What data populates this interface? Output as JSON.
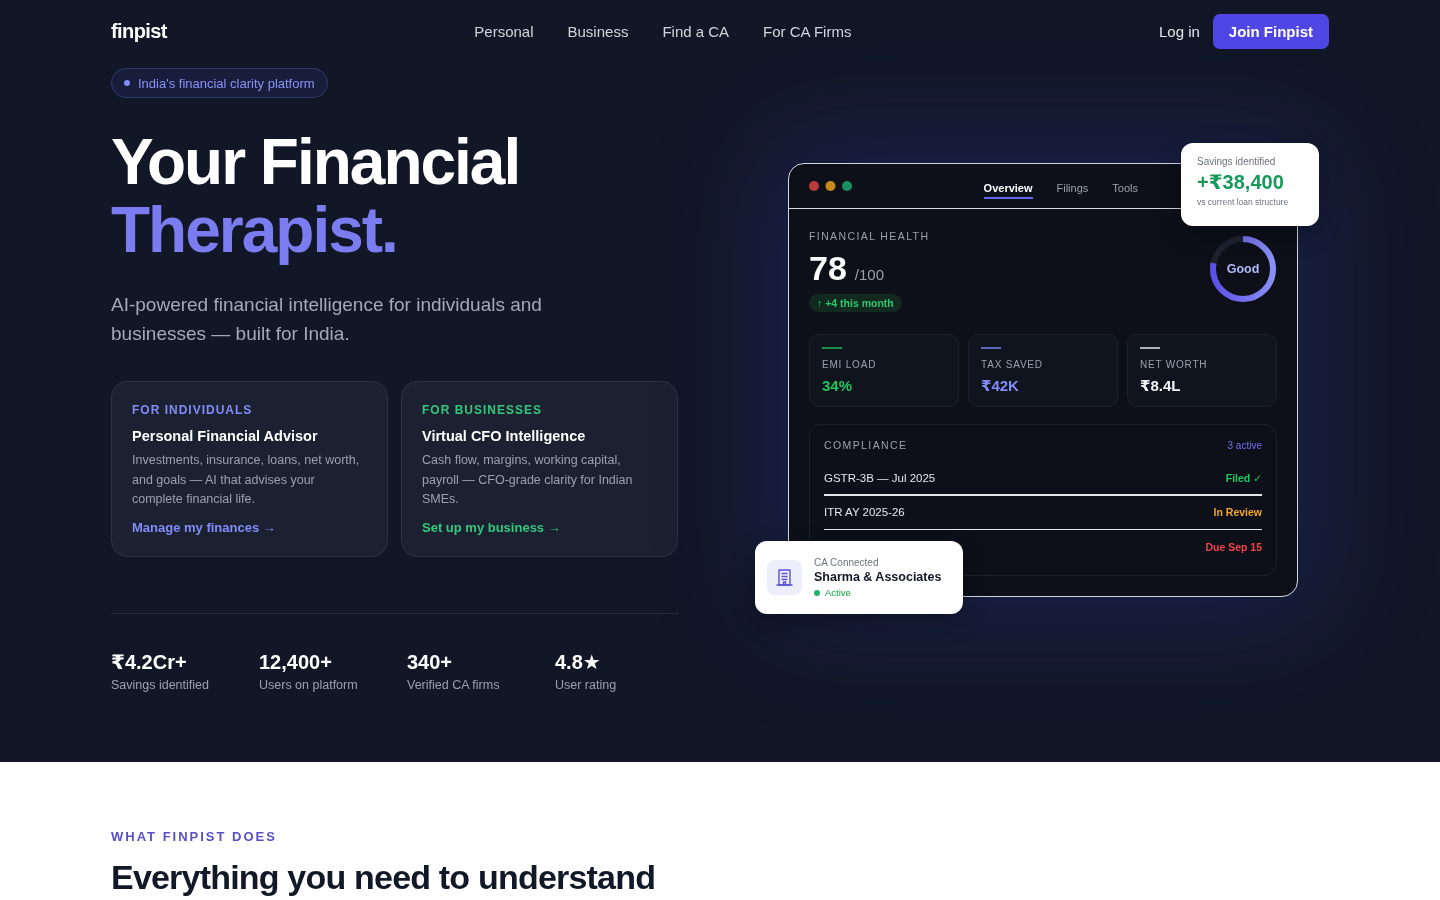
{
  "nav": {
    "logo": "finpist",
    "links": [
      {
        "label": "Personal"
      },
      {
        "label": "Business"
      },
      {
        "label": "Find a CA"
      },
      {
        "label": "For CA Firms"
      }
    ],
    "login": "Log in",
    "cta": "Join Finpist"
  },
  "hero": {
    "badge": "India's financial clarity platform",
    "title": "Your Financial",
    "title_accent": "Therapist.",
    "subtitle": "AI-powered financial intelligence for individuals and businesses — built for India.",
    "audience_cards": [
      {
        "eyebrow": "FOR INDIVIDUALS",
        "title": "Personal Financial Advisor",
        "description": "Investments, insurance, loans, net worth, and goals — AI that advises your complete financial life.",
        "link": "Manage my finances →",
        "color": "#818cf8"
      },
      {
        "eyebrow": "FOR BUSINESSES",
        "title": "Virtual CFO Intelligence",
        "description": "Cash flow, margins, working capital, payroll — CFO-grade clarity for Indian SMEs.",
        "link": "Set up my business →",
        "color": "#34c77b"
      }
    ],
    "stats": [
      {
        "value": "₹4.2Cr+",
        "label": "Savings identified"
      },
      {
        "value": "12,400+",
        "label": "Users on platform"
      },
      {
        "value": "340+",
        "label": "Verified CA firms"
      },
      {
        "value": "4.8★",
        "label": "User rating"
      }
    ]
  },
  "dashboard": {
    "tabs": [
      {
        "label": "Overview",
        "selected": true
      },
      {
        "label": "Filings",
        "selected": false
      },
      {
        "label": "Tools",
        "selected": false
      }
    ],
    "health": {
      "label": "FINANCIAL HEALTH",
      "score": "78",
      "score_max": "/100",
      "change": "↑ +4 this month",
      "rating": "Good",
      "level": 0.78
    },
    "metrics": [
      {
        "label": "EMI LOAD",
        "value": "34%",
        "color": "#22c55e"
      },
      {
        "label": "TAX SAVED",
        "value": "₹42K",
        "color": "#818cf8"
      },
      {
        "label": "NET WORTH",
        "value": "₹8.4L",
        "color": "#f3f4f6"
      }
    ],
    "compliance": {
      "title": "COMPLIANCE",
      "count": "3 active",
      "items": [
        {
          "name": "GSTR-3B — Jul 2025",
          "status": "Filed ✓",
          "color": "#22c55e"
        },
        {
          "name": "ITR AY 2025-26",
          "status": "In Review",
          "color": "#f5a524"
        },
        {
          "status": "Due Sep 15",
          "color": "#ef4444"
        }
      ]
    },
    "savings_card": {
      "label": "Savings identified",
      "amount": "+₹38,400",
      "note": "vs current loan structure"
    },
    "ca_card": {
      "label": "CA Connected",
      "name": "Sharma & Associates",
      "status": "Active"
    }
  },
  "features": {
    "eyebrow": "WHAT FINPIST DOES",
    "heading": "Everything you need to understand"
  }
}
